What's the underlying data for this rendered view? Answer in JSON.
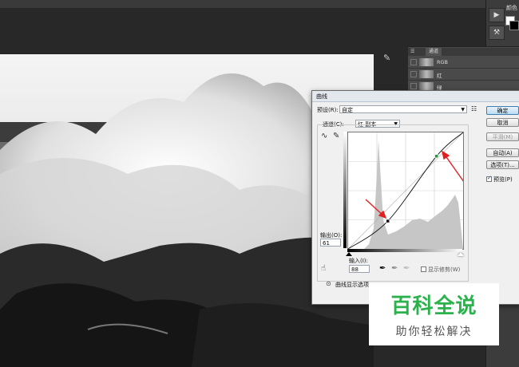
{
  "swatches": {
    "label": "颜色",
    "fg": "#ffffff",
    "bg": "#000000"
  },
  "channels_panel": {
    "tab": "通道",
    "rows": [
      {
        "label": "RGB"
      },
      {
        "label": "红"
      },
      {
        "label": "绿"
      }
    ]
  },
  "curves": {
    "title": "曲线",
    "preset_label": "预设(R):",
    "preset_value": "自定",
    "channel_label": "通道(C):",
    "channel_value": "红 副本",
    "output_label": "输出(O):",
    "output_value": "61",
    "input_label": "输入(I):",
    "input_value": "88",
    "show_clipping": "显示修剪(W)",
    "curve_display_options": "曲线显示选项",
    "buttons": {
      "ok": "确定",
      "cancel": "取消",
      "smooth": "平滑(M)",
      "auto": "自动(A)",
      "options": "选项(T)..."
    },
    "preview": {
      "label": "预览(P)",
      "checked": true
    },
    "curve_points": [
      {
        "input": 0,
        "output": 0
      },
      {
        "input": 88,
        "output": 61
      },
      {
        "input": 196,
        "output": 203
      },
      {
        "input": 255,
        "output": 255
      }
    ],
    "accent_arrow_color": "#e02020",
    "point_color": "#1a9a3a"
  },
  "watermark": {
    "title": "百科全说",
    "subtitle": "助你轻松解决",
    "color": "#2bb24c"
  },
  "icons": [
    "play-icon",
    "tool-icon",
    "eyedropper-icon",
    "curve-edit-icon",
    "pencil-icon",
    "hand-adjust-icon",
    "black-eyedropper-icon",
    "gray-eyedropper-icon",
    "white-eyedropper-icon",
    "expand-icon"
  ]
}
